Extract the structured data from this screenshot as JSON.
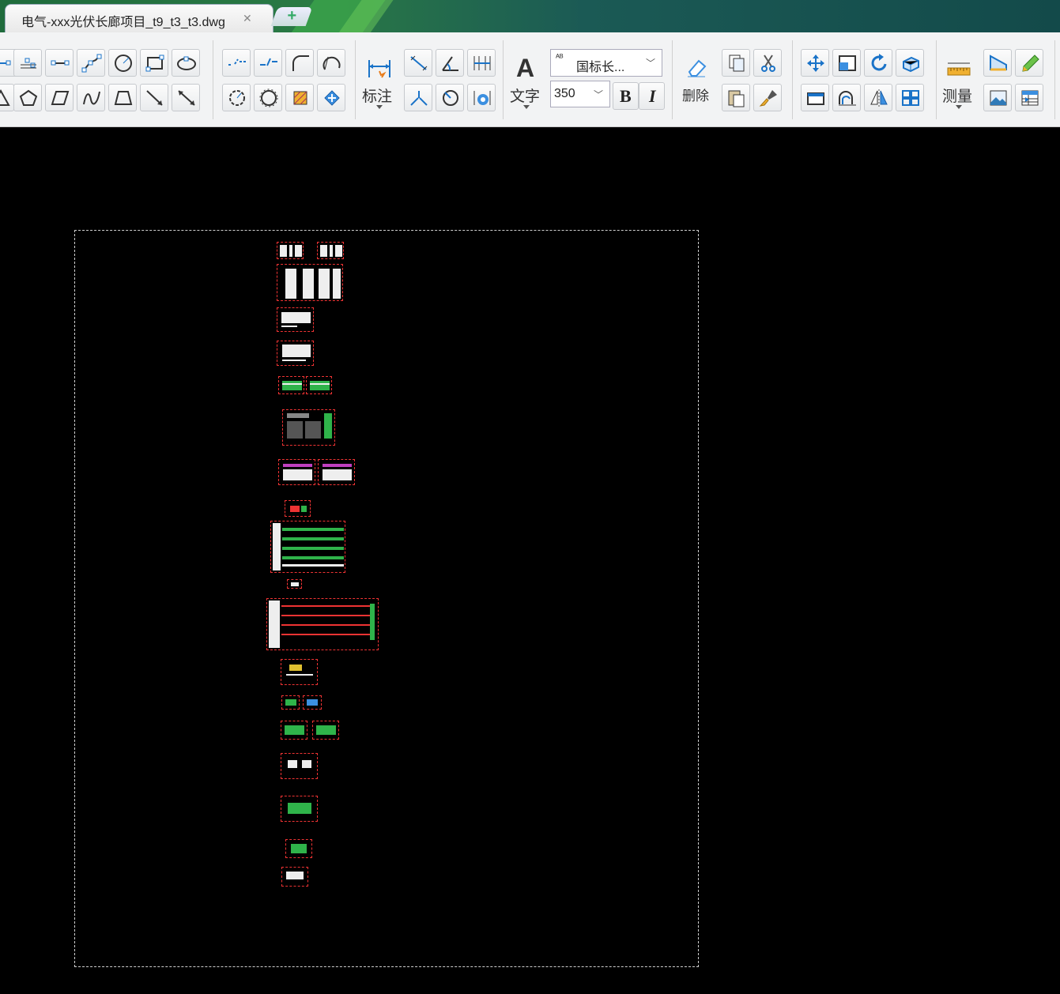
{
  "app": {
    "tab_title": "电气-xxx光伏长廊项目_t9_t3_t3.dwg",
    "tab_close": "✕",
    "new_tab": "+"
  },
  "ribbon": {
    "dimension_label": "标注",
    "text_label": "文字",
    "text_style_value": "国标长...",
    "text_size_value": "350",
    "bold_label": "B",
    "italic_label": "I",
    "delete_label": "删除",
    "measure_label": "测量"
  },
  "colors": {
    "tab_green": "#1f6b3c",
    "ribbon_bg": "#f2f3f4",
    "canvas_bg": "#000000",
    "frame_red": "#e33333",
    "icon_blue": "#1a73c8"
  }
}
